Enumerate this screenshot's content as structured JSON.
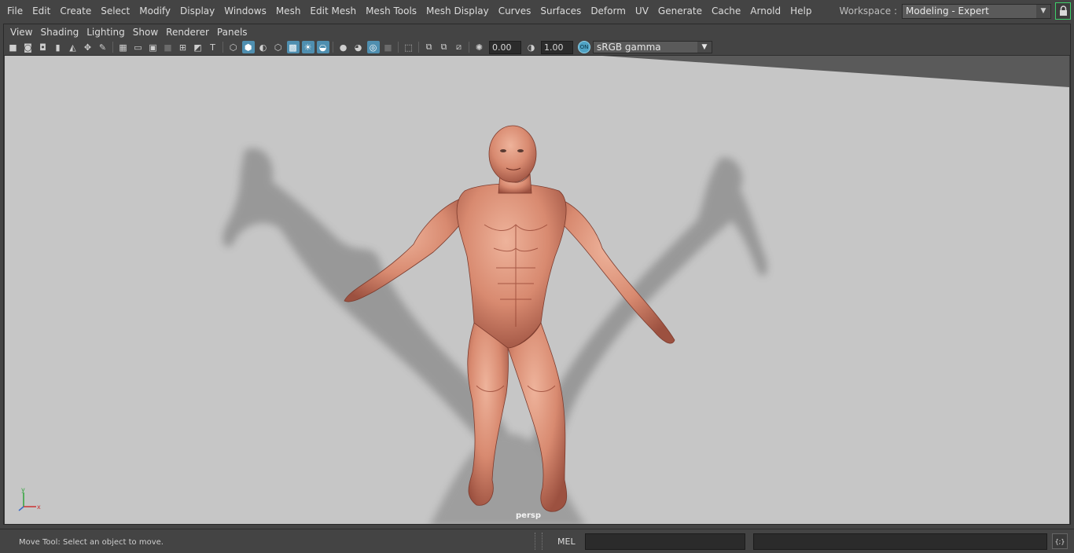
{
  "menubar": {
    "items": [
      "File",
      "Edit",
      "Create",
      "Select",
      "Modify",
      "Display",
      "Windows",
      "Mesh",
      "Edit Mesh",
      "Mesh Tools",
      "Mesh Display",
      "Curves",
      "Surfaces",
      "Deform",
      "UV",
      "Generate",
      "Cache",
      "Arnold",
      "Help"
    ]
  },
  "workspace": {
    "label": "Workspace :",
    "value": "Modeling - Expert"
  },
  "panel_menu": {
    "items": [
      "View",
      "Shading",
      "Lighting",
      "Show",
      "Renderer",
      "Panels"
    ]
  },
  "toolbar": {
    "exposure": "0.00",
    "gamma": "1.00",
    "color_space": "sRGB gamma",
    "icons": [
      "camera-icon",
      "camera-attributes-icon",
      "bookmark-icon",
      "image-plane-icon",
      "grid-icon",
      "film-gate-icon",
      "resolution-gate-icon",
      "gate-mask-icon",
      "field-chart-icon",
      "safe-action-icon",
      "safe-title-icon",
      "wireframe-icon",
      "smooth-shade-icon",
      "default-material-icon",
      "xray-icon",
      "use-all-lights-icon",
      "shadows-icon",
      "screen-space-ao-icon",
      "motion-blur-icon",
      "isolate-select-icon",
      "xray-joints-icon",
      "xray-components-icon",
      "exposure-icon",
      "gamma-icon"
    ]
  },
  "viewport": {
    "camera": "persp",
    "axis_x": "x",
    "axis_y": "y"
  },
  "statusbar": {
    "message": "Move Tool: Select an object to move.",
    "mel_label": "MEL"
  },
  "colors": {
    "accent": "#4f8fb0",
    "viewport_bg": "#c6c6c6",
    "lock_green": "#3fcf6a",
    "skin": "#d88a70"
  }
}
